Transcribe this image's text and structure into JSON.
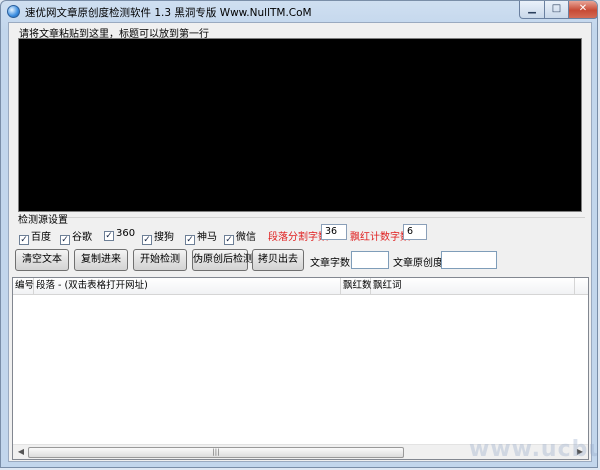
{
  "window": {
    "title": "速优网文章原创度检测软件 1.3    黑洞专版 Www.NullTM.CoM",
    "min_glyph": "▁",
    "max_glyph": "□",
    "close_glyph": "✕"
  },
  "editor": {
    "label": "请将文章粘贴到这里，标题可以放到第一行"
  },
  "sources": {
    "group_label": "检测源设置",
    "checkboxes": [
      {
        "label": "百度",
        "checked": true
      },
      {
        "label": "谷歌",
        "checked": true
      },
      {
        "label": "360",
        "checked": true
      },
      {
        "label": "搜狗",
        "checked": true
      },
      {
        "label": "神马",
        "checked": true
      },
      {
        "label": "微信",
        "checked": true
      }
    ],
    "check_glyph": "✓",
    "segment_label": "段落分割字数:",
    "segment_value": "36",
    "redword_label": "飘红计数字数:",
    "redword_value": "6"
  },
  "toolbar": {
    "clear_label": "清空文本",
    "paste_label": "复制进来",
    "start_label": "开始检测",
    "pseudo_label": "伪原创后检测",
    "export_label": "拷贝出去",
    "wordcount_label": "文章字数:",
    "wordcount_value": "",
    "originality_label": "文章原创度:",
    "originality_value": ""
  },
  "results": {
    "columns": [
      "编号",
      "段落 - (双击表格打开网址)",
      "飘红数",
      "飘红词"
    ],
    "rows": [],
    "scroll_left": "◀",
    "scroll_right": "▶",
    "thumb_grip": "|||"
  },
  "watermark": "www.ucbug.cc",
  "colors": {
    "accent_red": "#e02020",
    "editor_bg": "#000000"
  }
}
